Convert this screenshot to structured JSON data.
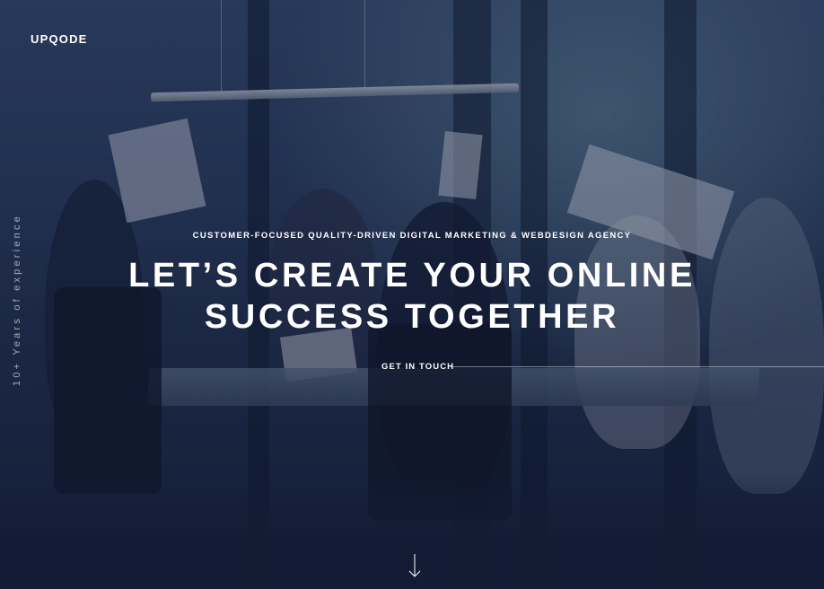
{
  "brand": {
    "logo": "UPQODE"
  },
  "side": {
    "experience": "10+ Years of experience"
  },
  "hero": {
    "tagline": "CUSTOMER-FOCUSED QUALITY-DRIVEN DIGITAL MARKETING & WEBDESIGN AGENCY",
    "headline_line1": "LET’S CREATE YOUR ONLINE",
    "headline_line2": "SUCCESS TOGETHER",
    "cta_label": "GET IN TOUCH"
  },
  "icons": {
    "scroll": "arrow-down-icon"
  },
  "colors": {
    "overlay": "#16203c",
    "text": "#ffffff",
    "accent_line": "#8a95ab"
  }
}
